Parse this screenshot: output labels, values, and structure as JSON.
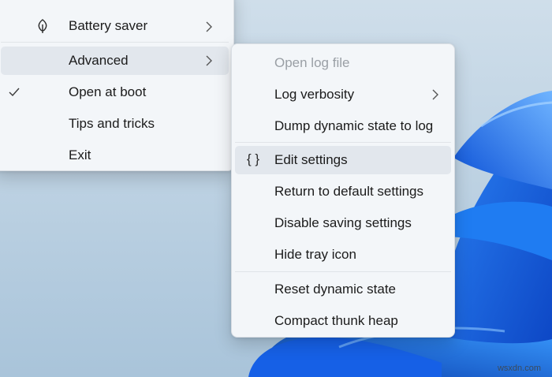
{
  "main_menu": {
    "items": [
      {
        "label": "Battery saver",
        "icon": "leaf-icon",
        "has_submenu": true
      },
      {
        "label": "Advanced",
        "icon": "",
        "has_submenu": true,
        "highlighted": true
      },
      {
        "label": "Open at boot",
        "icon": "checkmark-icon",
        "checked": true
      },
      {
        "label": "Tips and tricks",
        "icon": ""
      },
      {
        "label": "Exit",
        "icon": ""
      }
    ]
  },
  "advanced_menu": {
    "items": [
      {
        "label": "Open log file",
        "disabled": true
      },
      {
        "label": "Log verbosity",
        "has_submenu": true
      },
      {
        "label": "Dump dynamic state to log"
      },
      {
        "label": "Edit settings",
        "icon": "braces-icon",
        "icon_text": "{ }",
        "highlighted": true
      },
      {
        "label": "Return to default settings"
      },
      {
        "label": "Disable saving settings"
      },
      {
        "label": "Hide tray icon"
      },
      {
        "label": "Reset dynamic state"
      },
      {
        "label": "Compact thunk heap"
      }
    ]
  },
  "watermark": "wsxdn.com",
  "colors": {
    "desktop_bg": "#c7d8e6",
    "wallpaper_bloom": "#0a62e0",
    "menu_bg": "#f3f6f9",
    "hover_bg": "#e2e7ed",
    "disabled_text": "#9a9fa5"
  }
}
